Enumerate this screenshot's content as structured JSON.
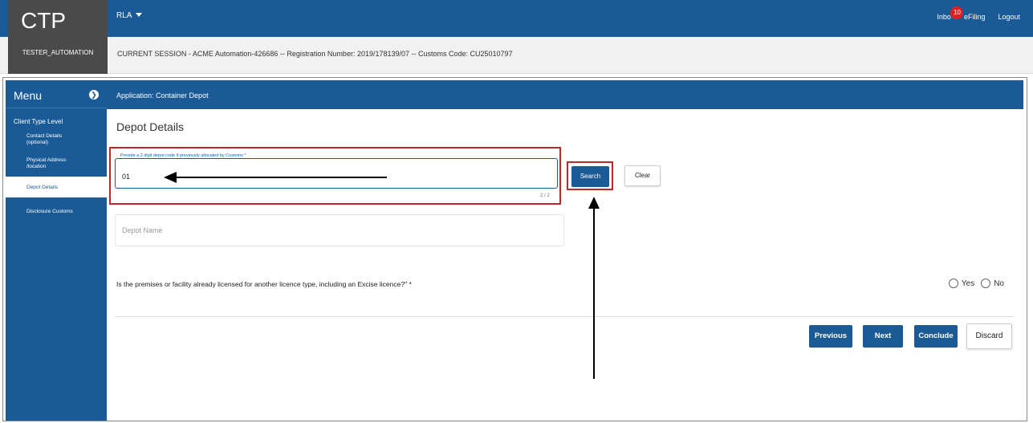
{
  "header": {
    "logo": "CTP",
    "role_menu": "RLA",
    "inbox_label": "Inbo",
    "inbox_count": "10",
    "efiling": "eFiling",
    "logout": "Logout"
  },
  "session": {
    "user": "TESTER_AUTOMATION",
    "text": "CURRENT SESSION - ACME Automation-426686 -- Registration Number: 2019/178139/07 -- Customs Code: CU25010797"
  },
  "sidebar": {
    "title": "Menu",
    "level": "Client Type Level",
    "items": [
      {
        "label": "Contact Details (optional)"
      },
      {
        "label": "Physical Address /location"
      },
      {
        "label": "Depot Details"
      },
      {
        "label": "Disclosure Customs"
      }
    ]
  },
  "main": {
    "application": "Application: Container Depot",
    "page_title": "Depot Details",
    "depot_code_label": "Provide a 2 digit depot code if previously allocated by Customs *",
    "depot_code_value": "01",
    "depot_code_counter": "2 / 2",
    "search_label": "Search",
    "clear_label": "Clear",
    "depot_name_placeholder": "Depot Name",
    "question": "Is the premises or facility already licensed for another licence type, including an Excise licence?\" *",
    "yes_label": "Yes",
    "no_label": "No"
  },
  "footer": {
    "previous": "Previous",
    "next": "Next",
    "conclude": "Conclude",
    "discard": "Discard"
  },
  "colors": {
    "primary": "#1a5a96",
    "highlight": "#c0272d",
    "badge": "#e02020"
  }
}
